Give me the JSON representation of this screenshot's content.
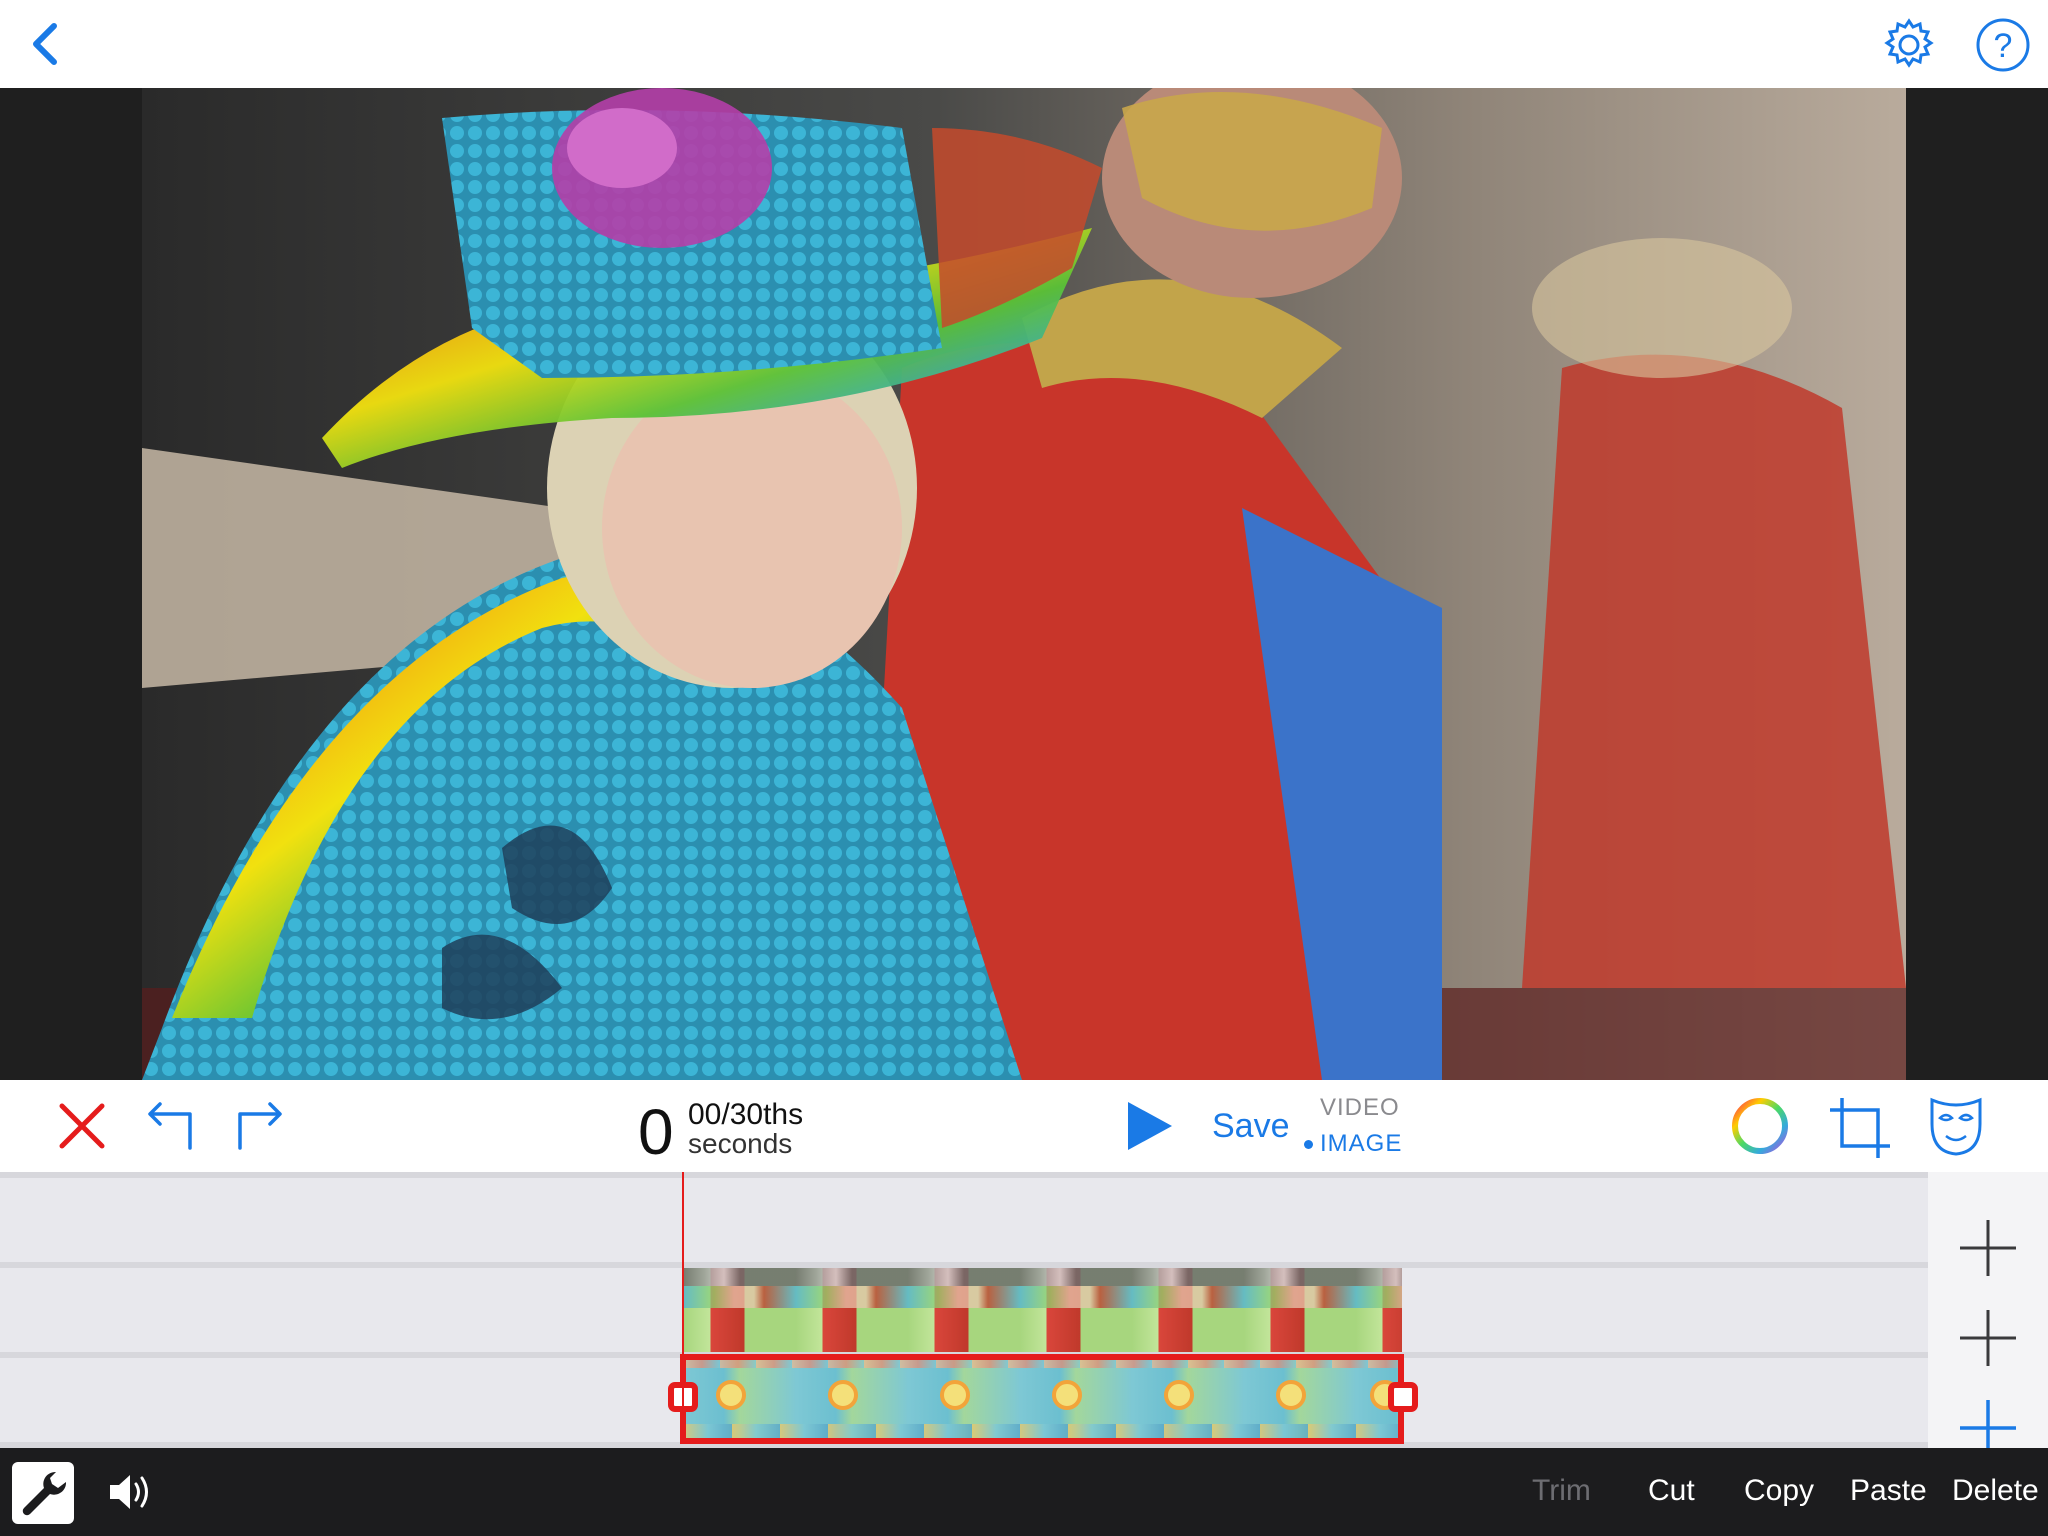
{
  "topbar": {
    "back_icon": "chevron-left-icon",
    "settings_icon": "gear-icon",
    "help_icon": "question-circle-icon",
    "help_glyph": "?"
  },
  "preview": {
    "content": "photo"
  },
  "toolbar": {
    "delete_icon": "x-icon",
    "undo_icon": "undo-icon",
    "redo_icon": "redo-icon",
    "time": {
      "seconds": "0",
      "frames": "00",
      "frames_suffix": "/30ths",
      "unit": "seconds"
    },
    "play_icon": "play-icon",
    "save_label": "Save",
    "mode_video": "VIDEO",
    "mode_image": "IMAGE",
    "selected_mode": "IMAGE",
    "color_icon": "color-wheel-icon",
    "crop_icon": "crop-icon",
    "mask_icon": "mask-icon"
  },
  "timeline": {
    "tracks": [
      {
        "clip": null
      },
      {
        "clip": "people-photo"
      },
      {
        "clip": "pattern-image",
        "selected": true
      }
    ],
    "add_icon": "plus-icon"
  },
  "bottombar": {
    "tools_icon": "wrench-icon",
    "sound_icon": "speaker-icon",
    "trim": "Trim",
    "cut": "Cut",
    "copy": "Copy",
    "paste": "Paste",
    "delete": "Delete"
  },
  "colors": {
    "accent": "#1a7ae6",
    "danger": "#e51c1c",
    "bottom_bar": "#1c1c1e",
    "preview_bg": "#1f1f1f"
  }
}
